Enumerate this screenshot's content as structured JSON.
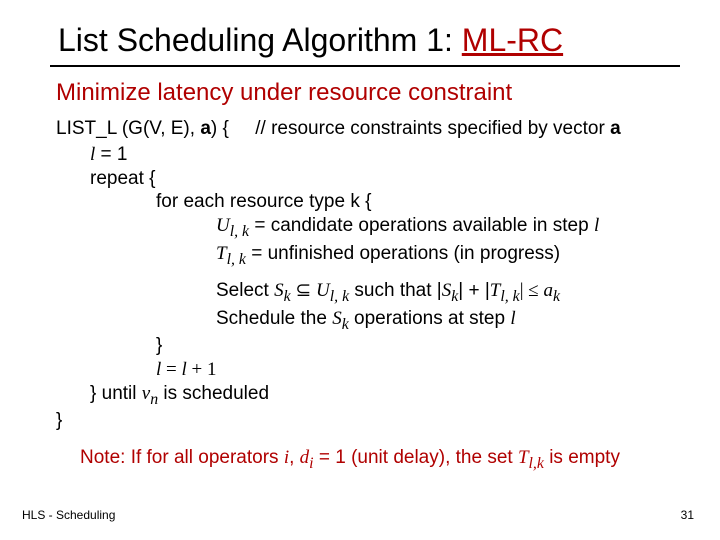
{
  "title": {
    "plain": "List Scheduling Algorithm 1: ",
    "red": "ML-RC"
  },
  "subtitle": "Minimize latency under resource constraint",
  "code": {
    "sig_left": "LIST_L (G(V, E), ",
    "sig_bold_a": "a",
    "sig_close": ") {",
    "sig_comment_pre": "// resource constraints specified by vector ",
    "sig_comment_a": "a",
    "init": " = 1",
    "init_var": "l",
    "repeat": "repeat {",
    "for": "for each resource type k {",
    "u_lbl": "U",
    "u_sub": "l, k",
    "u_txt": " = candidate operations available in step ",
    "u_end": "l",
    "t_lbl": "T",
    "t_sub": "l, k",
    "t_txt": " = unfinished operations (in progress)",
    "sel_pre": "Select ",
    "sel_sk": "S",
    "sel_sk_sub": "k",
    "sel_subset": " ⊆ ",
    "sel_u": "U",
    "sel_u_sub": "l, k",
    "sel_mid": " such that  |",
    "sel_sk2": "S",
    "sel_sk2_sub": "k",
    "sel_plus": "| + |",
    "sel_t": "T",
    "sel_t_sub": "l, k",
    "sel_le": "| ≤ ",
    "sel_a": "a",
    "sel_a_sub": "k",
    "sched_pre": "Schedule the ",
    "sched_sk": "S",
    "sched_sk_sub": "k",
    "sched_post": " operations at step ",
    "sched_l": "l",
    "close_for": "}",
    "linc_l": "l",
    "linc_eq": " = ",
    "linc_l2": "l ",
    "linc_plus": "+ 1",
    "until_pre": "} until ",
    "until_v": "v",
    "until_n": "n",
    "until_post": " is scheduled",
    "close_all": "}"
  },
  "note": {
    "p1": "Note: If for all operators ",
    "i1": "i",
    "p2": ", ",
    "i2": "d",
    "i2sub": "i",
    "p3": " = 1 (unit delay), the set ",
    "t": "T",
    "tsub": "l,k",
    "p4": " is empty"
  },
  "footer": {
    "left": "HLS - Scheduling",
    "right": "31"
  }
}
